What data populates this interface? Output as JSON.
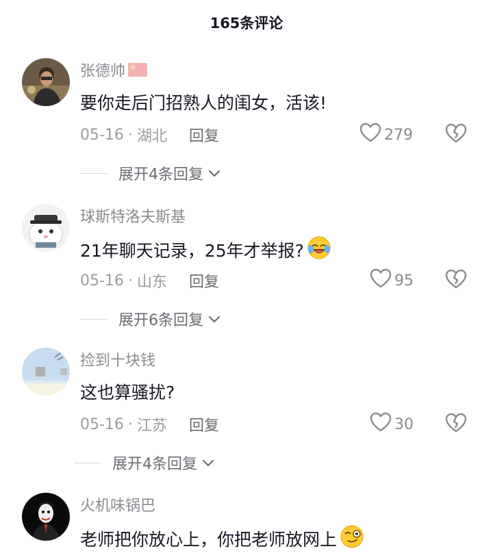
{
  "header": {
    "title": "165条评论"
  },
  "comments": [
    {
      "username": "张德帅",
      "text": "要你走后门招熟人的闺女，活该!",
      "date": "05-16",
      "sep": "·",
      "location": "湖北",
      "reply_label": "回复",
      "likes": "279",
      "expand_label": "展开4条回复"
    },
    {
      "username": "球斯特洛夫斯基",
      "text": "21年聊天记录，25年才举报?",
      "date": "05-16",
      "sep": "·",
      "location": "山东",
      "reply_label": "回复",
      "likes": "95",
      "expand_label": "展开6条回复"
    },
    {
      "username": "捡到十块钱",
      "text": "这也算骚扰?",
      "date": "05-16",
      "sep": "·",
      "location": "江苏",
      "reply_label": "回复",
      "likes": "30",
      "expand_label": "展开4条回复"
    },
    {
      "username": "火机味锅巴",
      "text": "老师把你放心上，你把老师放网上"
    }
  ],
  "colors": {
    "text": "#161823",
    "meta": "#9a9ba1",
    "accent": "#8a8b91"
  },
  "icons": [
    "flag-icon",
    "heart-icon",
    "broken-heart-icon",
    "chevron-down-icon",
    "laughing-emoji-icon",
    "smirk-emoji-icon"
  ]
}
